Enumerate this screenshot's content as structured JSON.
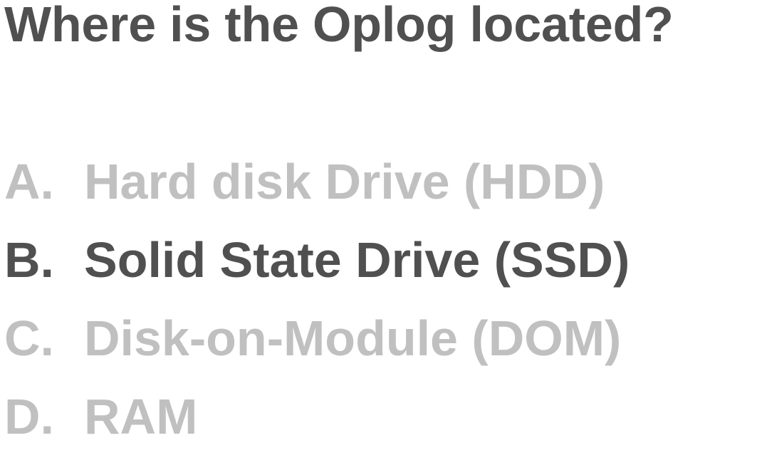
{
  "question": "Where is the Oplog located?",
  "options": [
    {
      "letter": "A.",
      "text": "Hard disk Drive (HDD)",
      "state": "dimmed"
    },
    {
      "letter": "B.",
      "text": "Solid State Drive (SSD)",
      "state": "highlighted"
    },
    {
      "letter": "C.",
      "text": "Disk-on-Module (DOM)",
      "state": "dimmed"
    },
    {
      "letter": "D.",
      "text": "RAM",
      "state": "dimmed"
    }
  ],
  "colors": {
    "highlighted": "#505050",
    "dimmed": "#c0c0c0",
    "background": "#ffffff"
  }
}
